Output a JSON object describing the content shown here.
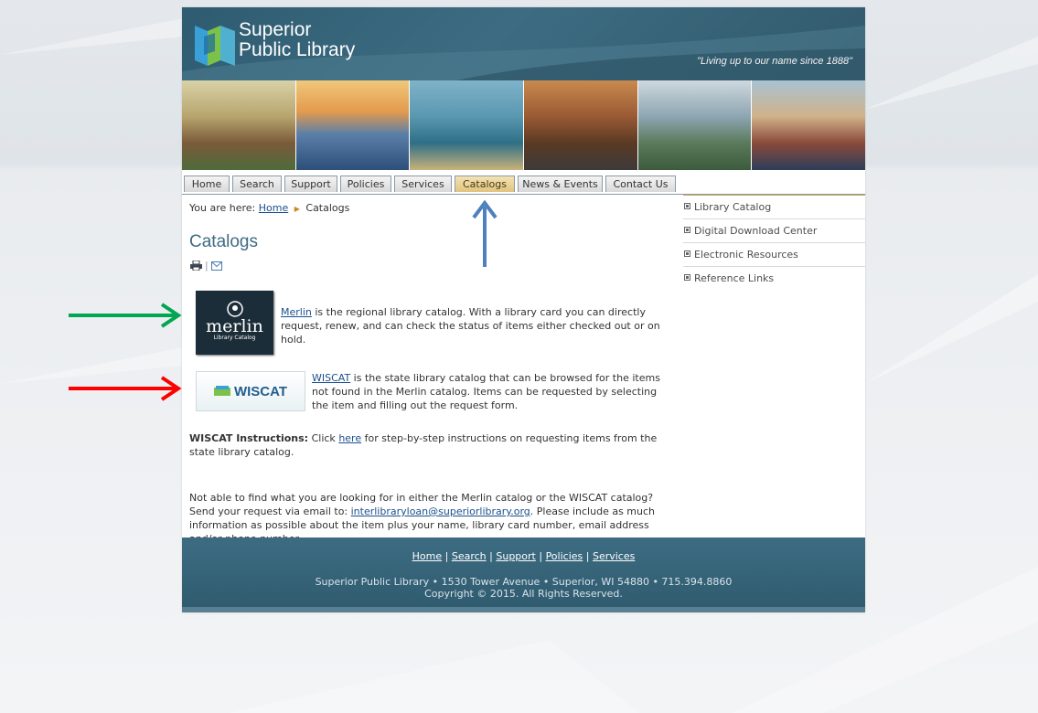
{
  "header": {
    "logo_line1": "Superior",
    "logo_line2": "Public Library",
    "tagline": "\"Living up to our name since 1888\""
  },
  "nav": {
    "tabs": [
      {
        "label": "Home"
      },
      {
        "label": "Search"
      },
      {
        "label": "Support"
      },
      {
        "label": "Policies"
      },
      {
        "label": "Services"
      },
      {
        "label": "Catalogs",
        "active": true
      },
      {
        "label": "News & Events"
      },
      {
        "label": "Contact Us"
      }
    ]
  },
  "breadcrumb": {
    "prefix": "You are here:",
    "home": "Home",
    "current": "Catalogs"
  },
  "page_title": "Catalogs",
  "content": {
    "merlin": {
      "logo_main": "merlin",
      "logo_sub": "Library Catalog",
      "link": "Merlin",
      "text": " is the regional library catalog. With a library card you can directly request, renew, and can check the status of items either checked out or on hold."
    },
    "wiscat": {
      "logo_text": "WISCAT",
      "link": "WISCAT",
      "text": " is the state library catalog that can be browsed for the items not found in the Merlin catalog.  Items can be requested by selecting the item and filling out the request form."
    },
    "instructions": {
      "bold": "WISCAT Instructions:",
      "pre": " Click ",
      "link": "here",
      "post": " for step-by-step instructions on requesting items from the state library catalog."
    },
    "help": {
      "pre": "Not able to find what you are looking for in either the Merlin catalog or the WISCAT catalog? Send your request via email to: ",
      "email": "interlibraryloan@superiorlibrary.org",
      "post": ". Please include as much information as possible about the item plus your name, library card number, email address and/or phone number."
    }
  },
  "sidebar": {
    "items": [
      {
        "label": "Library Catalog"
      },
      {
        "label": "Digital Download Center"
      },
      {
        "label": "Electronic Resources"
      },
      {
        "label": "Reference Links"
      }
    ]
  },
  "footer": {
    "links": [
      "Home",
      "Search",
      "Support",
      "Policies",
      "Services"
    ],
    "separator": "|",
    "address": "Superior Public Library • 1530 Tower Avenue • Superior, WI 54880 • 715.394.8860",
    "copyright": "Copyright © 2015. All Rights Reserved."
  },
  "colors": {
    "header_blue": "#3d6c82",
    "active_tab": "#e2c47f",
    "arrow_blue": "#4f81bd",
    "arrow_green": "#00a651",
    "arrow_red": "#ff0000"
  },
  "icons": [
    "print-icon",
    "email-icon",
    "bullet-icon",
    "arrow-up-icon",
    "arrow-right-icon"
  ]
}
